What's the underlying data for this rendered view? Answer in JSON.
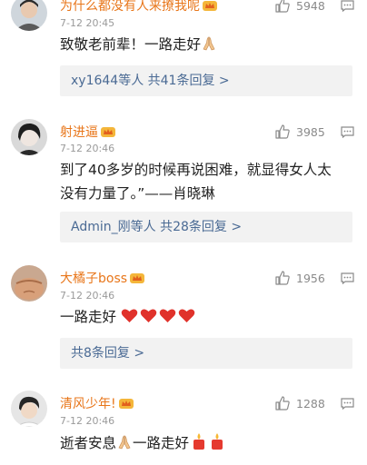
{
  "colors": {
    "username": "#e8761a",
    "link": "#4a6a94",
    "muted": "#9a9a9a",
    "reply_bg": "#f2f2f2",
    "heart": "#e0322b"
  },
  "comments": [
    {
      "username": "为什么都没有人来撩我呢",
      "time": "7-12 20:45",
      "likes": "5948",
      "text_parts": [
        "致敬老前辈！一路走好"
      ],
      "emojis": [
        "praying-hands-icon"
      ],
      "replies": "xy1644等人  共41条回复 >"
    },
    {
      "username": "射进逼",
      "time": "7-12 20:46",
      "likes": "3985",
      "text_line1": "到了40多岁的时候再说困难，就显得女人太",
      "text_line2": "没有力量了。”——肖晓琳",
      "replies": "Admin_刚等人  共28条回复 >"
    },
    {
      "username": "大橘子boss",
      "time": "7-12 20:46",
      "likes": "1956",
      "text_parts": [
        "一路走好"
      ],
      "emojis": [
        "heart-icon",
        "heart-icon",
        "heart-icon",
        "heart-icon"
      ],
      "replies": "共8条回复 >"
    },
    {
      "username": "清风少年!",
      "time": "7-12 20:46",
      "likes": "1288",
      "text_parts": [
        "逝者安息",
        "一路走好"
      ],
      "emojis": [
        "praying-hands-icon",
        "candle-icon",
        "candle-icon"
      ]
    }
  ]
}
